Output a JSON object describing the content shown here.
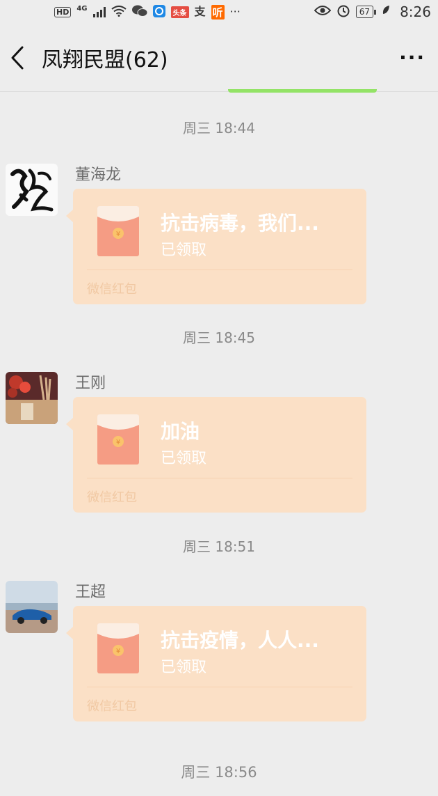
{
  "status_bar": {
    "hd": "HD",
    "network": "4G",
    "badge_toutiao": "头条",
    "badge_zhi": "支",
    "badge_ting": "听",
    "more": "···",
    "battery": "67",
    "time": "8:26"
  },
  "header": {
    "title": "凤翔民盟(62)",
    "more": "···"
  },
  "colors": {
    "background": "#ededed",
    "red_packet": "#fbe0c6",
    "envelope": "#f59c84",
    "green_strip": "#93e366"
  },
  "messages": [
    {
      "time": "周三 18:44",
      "sender": "董海龙",
      "avatar_icon": "calligraphy-avatar",
      "title": "抗击病毒，我们...",
      "status": "已领取",
      "footer": "微信红包"
    },
    {
      "time": "周三 18:45",
      "sender": "王刚",
      "avatar_icon": "flowers-avatar",
      "title": "加油",
      "status": "已领取",
      "footer": "微信红包"
    },
    {
      "time": "周三 18:51",
      "sender": "王超",
      "avatar_icon": "car-avatar",
      "title": "抗击疫情，人人...",
      "status": "已领取",
      "footer": "微信红包"
    }
  ],
  "last_time": "周三 18:56"
}
